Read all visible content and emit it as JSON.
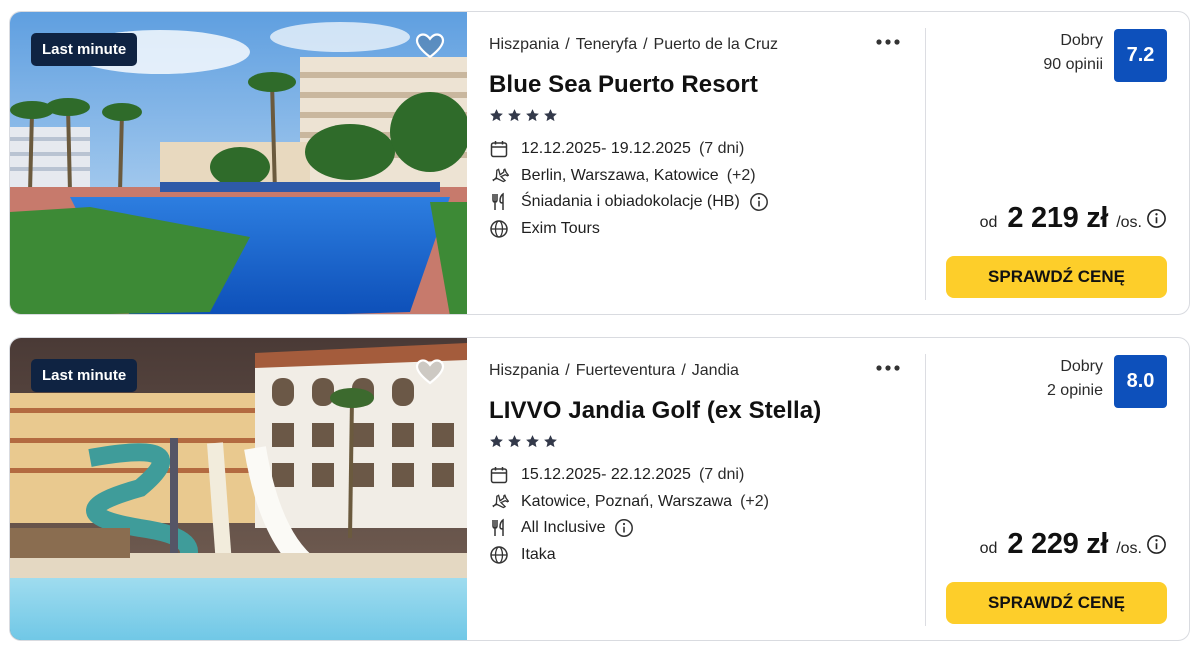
{
  "offers": [
    {
      "badge": "Last minute",
      "location": [
        "Hiszpania",
        "Teneryfa",
        "Puerto de la Cruz"
      ],
      "separator": "/",
      "title": "Blue Sea Puerto Resort",
      "stars": 4,
      "dates": "12.12.2025- 19.12.2025",
      "duration": "(7 dni)",
      "departures": "Berlin, Warszawa, Katowice",
      "departures_more": "(+2)",
      "board": "Śniadania i obiadokolacje (HB)",
      "operator": "Exim Tours",
      "rating_label": "Dobry",
      "reviews": "90 opinii",
      "score": "7.2",
      "price_prefix": "od",
      "price": "2 219 zł",
      "price_suffix": "/os.",
      "cta": "SPRAWDŹ CENĘ"
    },
    {
      "badge": "Last minute",
      "location": [
        "Hiszpania",
        "Fuerteventura",
        "Jandia"
      ],
      "separator": "/",
      "title": "LIVVO Jandia Golf (ex Stella)",
      "stars": 4,
      "dates": "15.12.2025- 22.12.2025",
      "duration": "(7 dni)",
      "departures": "Katowice, Poznań, Warszawa",
      "departures_more": "(+2)",
      "board": "All Inclusive",
      "operator": "Itaka",
      "rating_label": "Dobry",
      "reviews": "2 opinie",
      "score": "8.0",
      "price_prefix": "od",
      "price": "2 229 zł",
      "price_suffix": "/os.",
      "cta": "SPRAWDŹ CENĘ"
    }
  ],
  "colors": {
    "badge_bg": "#0f2342",
    "score_bg": "#0d50bb",
    "cta_bg": "#fdce2a"
  }
}
